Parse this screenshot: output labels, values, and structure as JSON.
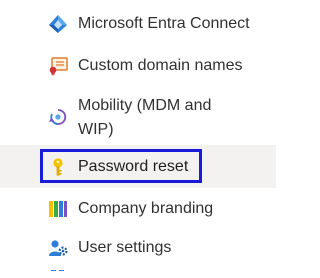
{
  "nav": {
    "items": [
      {
        "label": "Microsoft Entra Connect",
        "icon": "entra-connect-icon"
      },
      {
        "label": "Custom domain names",
        "icon": "custom-domain-icon"
      },
      {
        "label": "Mobility (MDM and WIP)",
        "icon": "mobility-icon"
      },
      {
        "label": "Password reset",
        "icon": "key-icon",
        "selected": true
      },
      {
        "label": "Company branding",
        "icon": "company-branding-icon"
      },
      {
        "label": "User settings",
        "icon": "user-settings-icon"
      }
    ],
    "selected_index": 3
  },
  "colors": {
    "focus_outline": "#1a1ad9",
    "selected_background": "#f3f2f1",
    "text": "#323130"
  }
}
